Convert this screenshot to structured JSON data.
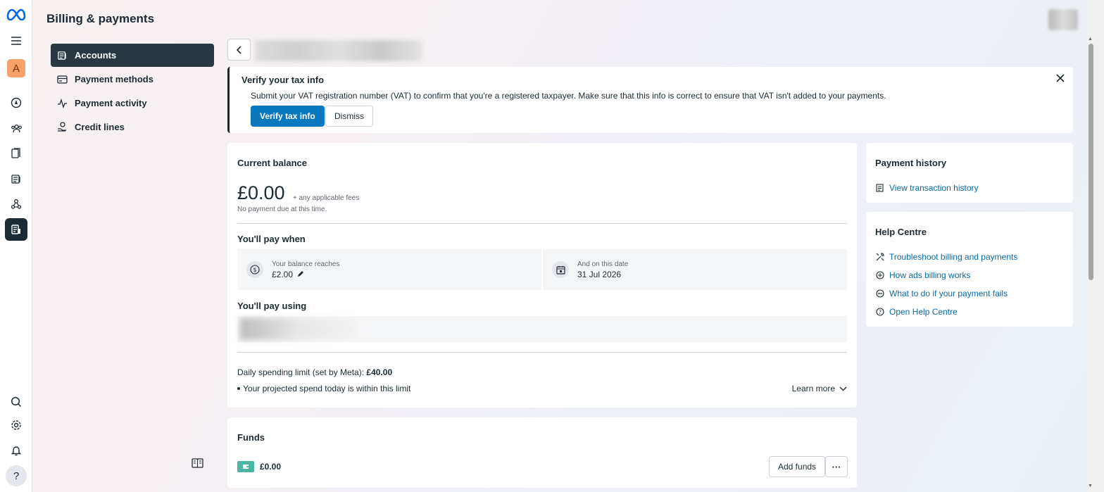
{
  "header": {
    "title": "Billing & payments"
  },
  "sidebar": {
    "items": [
      {
        "label": "Accounts",
        "icon": "accounts-icon",
        "active": true
      },
      {
        "label": "Payment methods",
        "icon": "card-icon",
        "active": false
      },
      {
        "label": "Payment activity",
        "icon": "activity-icon",
        "active": false
      },
      {
        "label": "Credit lines",
        "icon": "credit-lines-icon",
        "active": false
      }
    ]
  },
  "rail": {
    "avatar_letter": "A",
    "help_label": "?"
  },
  "tax_banner": {
    "title": "Verify your tax info",
    "description": "Submit your VAT registration number (VAT) to confirm that you're a registered taxpayer. Make sure that this info is correct to ensure that VAT isn't added to your payments.",
    "verify_label": "Verify tax info",
    "dismiss_label": "Dismiss"
  },
  "balance": {
    "heading": "Current balance",
    "amount": "£0.00",
    "fees_note": "+ any applicable fees",
    "status": "No payment due at this time.",
    "pay_when_heading": "You'll pay when",
    "threshold_label": "Your balance reaches",
    "threshold_value": "£2.00",
    "date_label": "And on this date",
    "date_value": "31 Jul 2026",
    "pay_using_heading": "You'll pay using",
    "limit_label": "Daily spending limit (set by Meta):",
    "limit_value": "£40.00",
    "within_text": "Your projected spend today is within this limit",
    "learn_more": "Learn more"
  },
  "funds": {
    "heading": "Funds",
    "amount": "£0.00",
    "add_label": "Add funds",
    "more_label": "···"
  },
  "history": {
    "heading": "Payment history",
    "link": "View transaction history"
  },
  "help_centre": {
    "heading": "Help Centre",
    "links": [
      "Troubleshoot billing and payments",
      "How ads billing works",
      "What to do if your payment fails",
      "Open Help Centre"
    ]
  },
  "colors": {
    "primary": "#0a78be",
    "link": "#0a6aa8",
    "active_nav": "#283740",
    "avatar": "#f6a06a",
    "funds_icon": "#4bb6a4"
  }
}
